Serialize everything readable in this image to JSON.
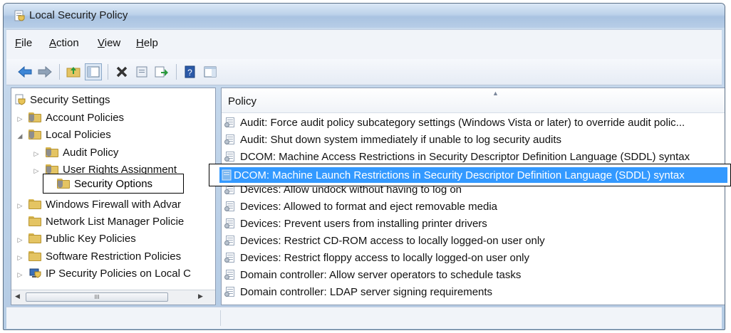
{
  "window": {
    "title": "Local Security Policy"
  },
  "menu": [
    {
      "label": "File",
      "accel": "F",
      "rest": "ile"
    },
    {
      "label": "Action",
      "accel": "A",
      "rest": "ction"
    },
    {
      "label": "View",
      "accel": "V",
      "rest": "iew"
    },
    {
      "label": "Help",
      "accel": "H",
      "rest": "elp"
    }
  ],
  "toolbar": {
    "icons": [
      "back-arrow-icon",
      "forward-arrow-icon",
      "up-folder-icon",
      "show-hide-tree-icon",
      "delete-icon",
      "properties-icon",
      "export-list-icon",
      "help-icon",
      "show-action-pane-icon"
    ]
  },
  "tree": {
    "items": [
      {
        "label": "Security Settings"
      },
      {
        "label": "Account Policies"
      },
      {
        "label": "Local Policies"
      },
      {
        "label": "Audit Policy"
      },
      {
        "label": "User Rights Assignment"
      },
      {
        "label": "Security Options"
      },
      {
        "label": "Windows Firewall with Advar"
      },
      {
        "label": "Network List Manager Policie"
      },
      {
        "label": "Public Key Policies"
      },
      {
        "label": "Software Restriction Policies"
      },
      {
        "label": "IP Security Policies on Local C"
      }
    ],
    "scroll_thumb": "III"
  },
  "list": {
    "column": "Policy",
    "rows": [
      {
        "label": "Audit: Force audit policy subcategory settings (Windows Vista or later) to override audit polic..."
      },
      {
        "label": "Audit: Shut down system immediately if unable to log security audits"
      },
      {
        "label": "DCOM: Machine Access Restrictions in Security Descriptor Definition Language (SDDL) syntax"
      },
      {
        "label": "DCOM: Machine Launch Restrictions in Security Descriptor Definition Language (SDDL) syntax"
      },
      {
        "label": "Devices: Allow undock without having to log on"
      },
      {
        "label": "Devices: Allowed to format and eject removable media"
      },
      {
        "label": "Devices: Prevent users from installing printer drivers"
      },
      {
        "label": "Devices: Restrict CD-ROM access to locally logged-on user only"
      },
      {
        "label": "Devices: Restrict floppy access to locally logged-on user only"
      },
      {
        "label": "Domain controller: Allow server operators to schedule tasks"
      },
      {
        "label": "Domain controller: LDAP server signing requirements"
      }
    ]
  },
  "colors": {
    "selection": "#3399ff",
    "titlebar": "#bcd2ea"
  }
}
